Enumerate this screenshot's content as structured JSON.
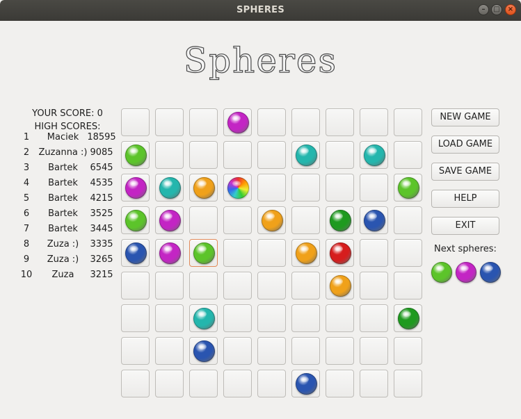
{
  "window": {
    "title": "SPHERES"
  },
  "logo": {
    "text": "Spheres"
  },
  "scores": {
    "your_score_label": "YOUR SCORE: 0",
    "high_scores_label": "HIGH SCORES:",
    "entries": [
      {
        "rank": "1",
        "name": "Maciek",
        "score": "18595"
      },
      {
        "rank": "2",
        "name": "Zuzanna :)",
        "score": "9085"
      },
      {
        "rank": "3",
        "name": "Bartek",
        "score": "6545"
      },
      {
        "rank": "4",
        "name": "Bartek",
        "score": "4535"
      },
      {
        "rank": "5",
        "name": "Bartek",
        "score": "4215"
      },
      {
        "rank": "6",
        "name": "Bartek",
        "score": "3525"
      },
      {
        "rank": "7",
        "name": "Bartek",
        "score": "3445"
      },
      {
        "rank": "8",
        "name": "Zuza :)",
        "score": "3335"
      },
      {
        "rank": "9",
        "name": "Zuza :)",
        "score": "3265"
      },
      {
        "rank": "10",
        "name": "Zuza",
        "score": "3215"
      }
    ]
  },
  "board": {
    "rows": 9,
    "cols": 9,
    "selected": [
      4,
      2
    ],
    "grid": [
      [
        null,
        null,
        null,
        "magenta",
        null,
        null,
        null,
        null,
        null
      ],
      [
        "green",
        null,
        null,
        null,
        null,
        "cyan",
        null,
        "cyan",
        null
      ],
      [
        "magenta",
        "cyan",
        "orange",
        "rainbow",
        null,
        null,
        null,
        null,
        "green"
      ],
      [
        "green",
        "magenta",
        null,
        null,
        "orange",
        null,
        "darkgreen",
        "blue",
        null
      ],
      [
        "blue",
        "magenta",
        "green",
        null,
        null,
        "orange",
        "red",
        null,
        null
      ],
      [
        null,
        null,
        null,
        null,
        null,
        null,
        "orange",
        null,
        null
      ],
      [
        null,
        null,
        "cyan",
        null,
        null,
        null,
        null,
        null,
        "darkgreen"
      ],
      [
        null,
        null,
        "blue",
        null,
        null,
        null,
        null,
        null,
        null
      ],
      [
        null,
        null,
        null,
        null,
        null,
        "blue",
        null,
        null,
        null
      ]
    ]
  },
  "menu": {
    "new_game": "NEW GAME",
    "load_game": "LOAD GAME",
    "save_game": "SAVE GAME",
    "help": "HELP",
    "exit": "EXIT"
  },
  "next": {
    "label": "Next spheres:",
    "colors": [
      "green",
      "magenta",
      "blue"
    ]
  },
  "colors": {
    "green": "#5cc42a",
    "magenta": "#c325c4",
    "cyan": "#24b6ad",
    "orange": "#f0a11a",
    "blue": "#2a55b0",
    "darkgreen": "#1f9a1f",
    "red": "#d61d1d"
  }
}
